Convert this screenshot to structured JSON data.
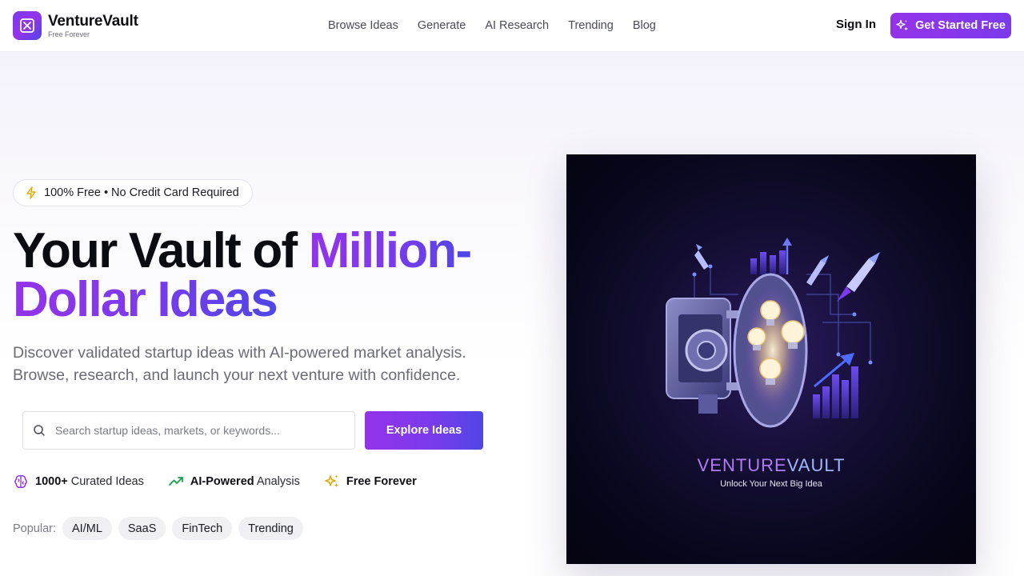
{
  "brand": {
    "name": "VentureVault",
    "tagline": "Free Forever",
    "accent": "#7c3aed"
  },
  "nav": {
    "links": [
      "Browse Ideas",
      "Generate",
      "AI Research",
      "Trending",
      "Blog"
    ],
    "sign_in": "Sign In",
    "cta": "Get Started Free"
  },
  "hero": {
    "badge": "100% Free • No Credit Card Required",
    "headline_plain": "Your Vault of ",
    "headline_accent_1": "Million-",
    "headline_accent_2": "Dollar Ideas",
    "subtitle": "Discover validated startup ideas with AI-powered market analysis. Browse, research, and launch your next venture with confidence.",
    "search_placeholder": "Search startup ideas, markets, or keywords...",
    "search_value": "",
    "explore_button": "Explore Ideas"
  },
  "features": [
    {
      "icon": "brain-icon",
      "bold": "1000+",
      "text": " Curated Ideas"
    },
    {
      "icon": "trending-up-icon",
      "bold": "AI-Powered",
      "text": " Analysis"
    },
    {
      "icon": "sparkles-icon",
      "bold": "Free Forever",
      "text": ""
    }
  ],
  "popular": {
    "label": "Popular:",
    "tags": [
      "AI/ML",
      "SaaS",
      "FinTech",
      "Trending"
    ]
  },
  "visual": {
    "title_part_1": "VENTURE",
    "title_part_2": "VAULT",
    "subtitle": "Unlock Your Next Big Idea"
  }
}
